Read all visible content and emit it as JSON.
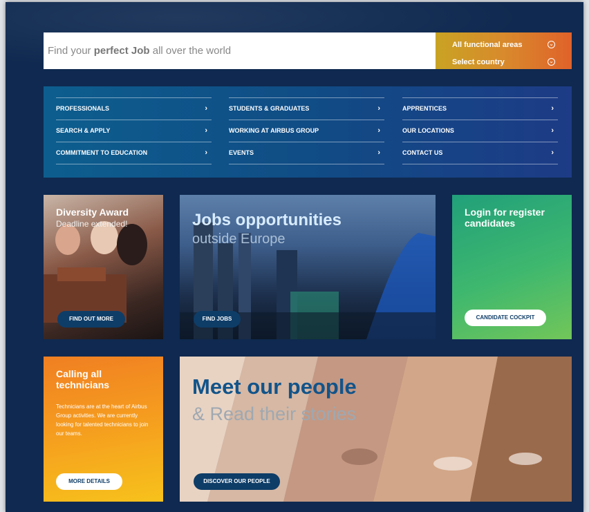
{
  "search": {
    "prefix": "Find your ",
    "bold": "perfect Job",
    "suffix": " all over the world",
    "filter_areas": "All functional areas",
    "filter_country": "Select country"
  },
  "nav": {
    "col1": [
      "PROFESSIONALS",
      "SEARCH & APPLY",
      "COMMITMENT TO EDUCATION"
    ],
    "col2": [
      "STUDENTS & GRADUATES",
      "WORKING AT AIRBUS GROUP",
      "EVENTS"
    ],
    "col3": [
      "APPRENTICES",
      "OUR LOCATIONS",
      "CONTACT US"
    ],
    "chevron": "›"
  },
  "tiles": {
    "diversity": {
      "title": "Diversity Award",
      "subtitle": "Deadline extended!",
      "button": "FIND OUT MORE"
    },
    "jobs": {
      "title": "Jobs opportunities",
      "subtitle": "outside Europe",
      "button": "FIND JOBS"
    },
    "login": {
      "title": "Login for register candidates",
      "button": "CANDIDATE COCKPIT"
    },
    "technicians": {
      "title": "Calling all technicians",
      "body": "Technicians are at the heart of Airbus Group activities. We are currently looking for talented technicians to join our teams.",
      "button": "MORE DETAILS"
    },
    "people": {
      "title": "Meet our people",
      "subtitle": "& Read their stories",
      "button": "DISCOVER OUR PEOPLE"
    }
  },
  "colors": {
    "background": "#0f2950",
    "accent_orange": "#f59b1f",
    "accent_green": "#3fb86e",
    "button_dark": "#0e3d68"
  }
}
